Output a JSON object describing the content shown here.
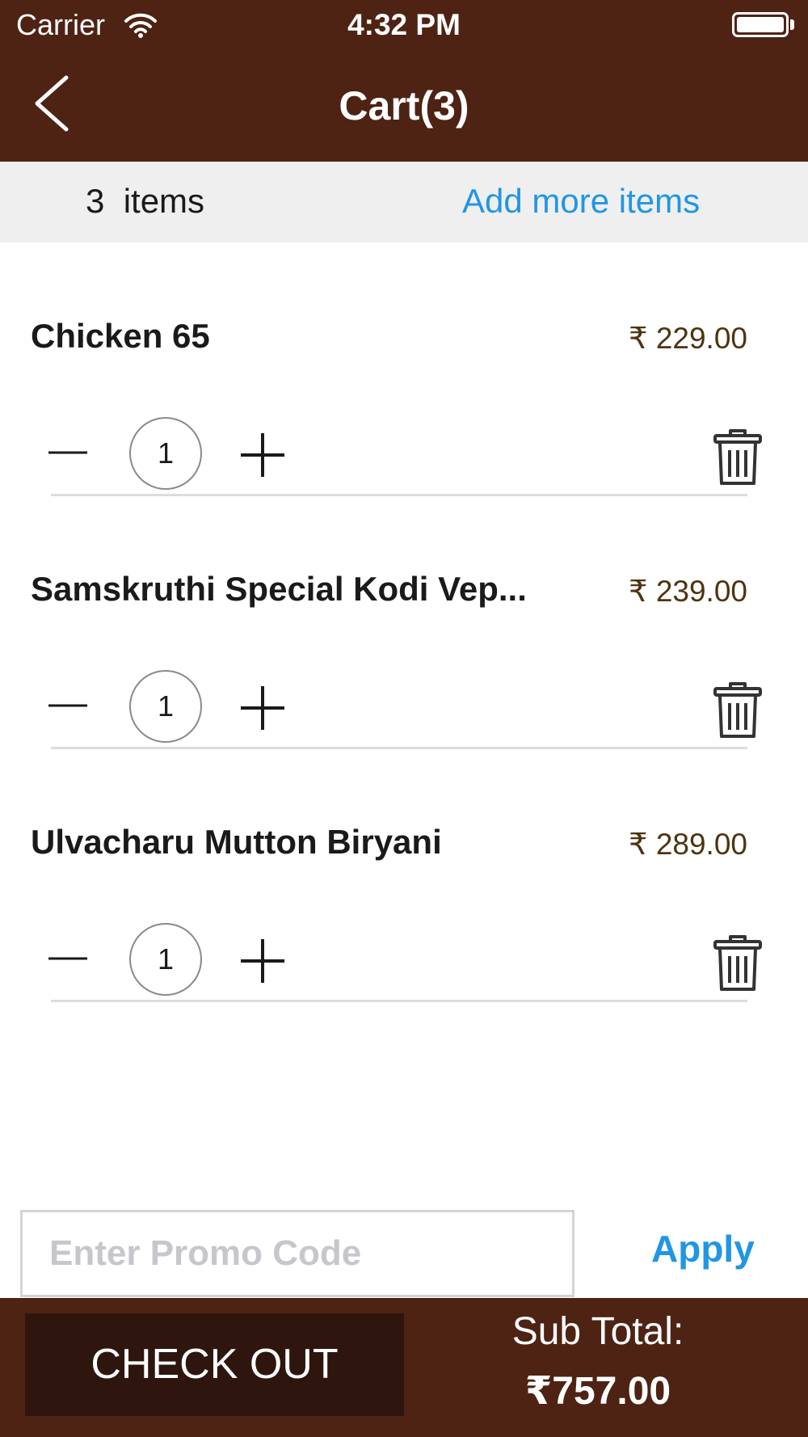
{
  "status_bar": {
    "carrier": "Carrier",
    "time": "4:32 PM"
  },
  "header": {
    "title": "Cart(3)"
  },
  "summary": {
    "items_count": "3  items",
    "add_more": "Add more items"
  },
  "items": [
    {
      "name": "Chicken 65",
      "price": "₹ 229.00",
      "quantity": "1"
    },
    {
      "name": "Samskruthi Special Kodi Vep...",
      "price": "₹ 239.00",
      "quantity": "1"
    },
    {
      "name": "Ulvacharu Mutton Biryani",
      "price": "₹ 289.00",
      "quantity": "1"
    }
  ],
  "promo": {
    "placeholder": "Enter Promo Code",
    "value": "",
    "apply_label": "Apply"
  },
  "footer": {
    "checkout_label": "CHECK OUT",
    "subtotal_label": "Sub Total:",
    "subtotal_value": "₹757.00"
  },
  "colors": {
    "brand_brown": "#4e2314",
    "checkout_dark": "#2e150e",
    "link_blue": "#2196e3",
    "price_brown": "#4e3410"
  },
  "icons": [
    "wifi-icon",
    "battery-icon",
    "back-chevron-icon",
    "minus-icon",
    "plus-icon",
    "trash-icon"
  ]
}
